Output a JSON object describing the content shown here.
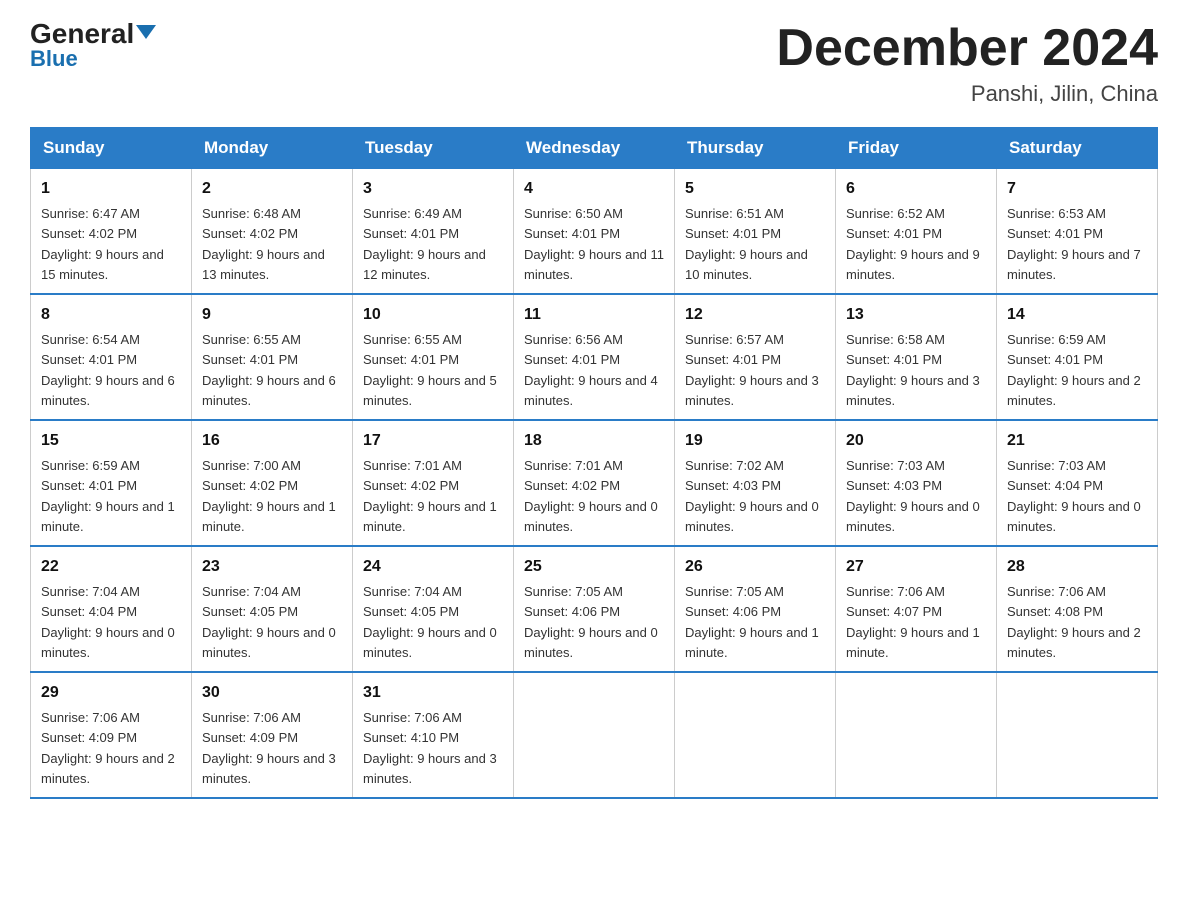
{
  "header": {
    "logo_general": "General",
    "logo_blue": "Blue",
    "month_title": "December 2024",
    "location": "Panshi, Jilin, China"
  },
  "days_of_week": [
    "Sunday",
    "Monday",
    "Tuesday",
    "Wednesday",
    "Thursday",
    "Friday",
    "Saturday"
  ],
  "weeks": [
    [
      {
        "day": "1",
        "sunrise": "6:47 AM",
        "sunset": "4:02 PM",
        "daylight": "9 hours and 15 minutes."
      },
      {
        "day": "2",
        "sunrise": "6:48 AM",
        "sunset": "4:02 PM",
        "daylight": "9 hours and 13 minutes."
      },
      {
        "day": "3",
        "sunrise": "6:49 AM",
        "sunset": "4:01 PM",
        "daylight": "9 hours and 12 minutes."
      },
      {
        "day": "4",
        "sunrise": "6:50 AM",
        "sunset": "4:01 PM",
        "daylight": "9 hours and 11 minutes."
      },
      {
        "day": "5",
        "sunrise": "6:51 AM",
        "sunset": "4:01 PM",
        "daylight": "9 hours and 10 minutes."
      },
      {
        "day": "6",
        "sunrise": "6:52 AM",
        "sunset": "4:01 PM",
        "daylight": "9 hours and 9 minutes."
      },
      {
        "day": "7",
        "sunrise": "6:53 AM",
        "sunset": "4:01 PM",
        "daylight": "9 hours and 7 minutes."
      }
    ],
    [
      {
        "day": "8",
        "sunrise": "6:54 AM",
        "sunset": "4:01 PM",
        "daylight": "9 hours and 6 minutes."
      },
      {
        "day": "9",
        "sunrise": "6:55 AM",
        "sunset": "4:01 PM",
        "daylight": "9 hours and 6 minutes."
      },
      {
        "day": "10",
        "sunrise": "6:55 AM",
        "sunset": "4:01 PM",
        "daylight": "9 hours and 5 minutes."
      },
      {
        "day": "11",
        "sunrise": "6:56 AM",
        "sunset": "4:01 PM",
        "daylight": "9 hours and 4 minutes."
      },
      {
        "day": "12",
        "sunrise": "6:57 AM",
        "sunset": "4:01 PM",
        "daylight": "9 hours and 3 minutes."
      },
      {
        "day": "13",
        "sunrise": "6:58 AM",
        "sunset": "4:01 PM",
        "daylight": "9 hours and 3 minutes."
      },
      {
        "day": "14",
        "sunrise": "6:59 AM",
        "sunset": "4:01 PM",
        "daylight": "9 hours and 2 minutes."
      }
    ],
    [
      {
        "day": "15",
        "sunrise": "6:59 AM",
        "sunset": "4:01 PM",
        "daylight": "9 hours and 1 minute."
      },
      {
        "day": "16",
        "sunrise": "7:00 AM",
        "sunset": "4:02 PM",
        "daylight": "9 hours and 1 minute."
      },
      {
        "day": "17",
        "sunrise": "7:01 AM",
        "sunset": "4:02 PM",
        "daylight": "9 hours and 1 minute."
      },
      {
        "day": "18",
        "sunrise": "7:01 AM",
        "sunset": "4:02 PM",
        "daylight": "9 hours and 0 minutes."
      },
      {
        "day": "19",
        "sunrise": "7:02 AM",
        "sunset": "4:03 PM",
        "daylight": "9 hours and 0 minutes."
      },
      {
        "day": "20",
        "sunrise": "7:03 AM",
        "sunset": "4:03 PM",
        "daylight": "9 hours and 0 minutes."
      },
      {
        "day": "21",
        "sunrise": "7:03 AM",
        "sunset": "4:04 PM",
        "daylight": "9 hours and 0 minutes."
      }
    ],
    [
      {
        "day": "22",
        "sunrise": "7:04 AM",
        "sunset": "4:04 PM",
        "daylight": "9 hours and 0 minutes."
      },
      {
        "day": "23",
        "sunrise": "7:04 AM",
        "sunset": "4:05 PM",
        "daylight": "9 hours and 0 minutes."
      },
      {
        "day": "24",
        "sunrise": "7:04 AM",
        "sunset": "4:05 PM",
        "daylight": "9 hours and 0 minutes."
      },
      {
        "day": "25",
        "sunrise": "7:05 AM",
        "sunset": "4:06 PM",
        "daylight": "9 hours and 0 minutes."
      },
      {
        "day": "26",
        "sunrise": "7:05 AM",
        "sunset": "4:06 PM",
        "daylight": "9 hours and 1 minute."
      },
      {
        "day": "27",
        "sunrise": "7:06 AM",
        "sunset": "4:07 PM",
        "daylight": "9 hours and 1 minute."
      },
      {
        "day": "28",
        "sunrise": "7:06 AM",
        "sunset": "4:08 PM",
        "daylight": "9 hours and 2 minutes."
      }
    ],
    [
      {
        "day": "29",
        "sunrise": "7:06 AM",
        "sunset": "4:09 PM",
        "daylight": "9 hours and 2 minutes."
      },
      {
        "day": "30",
        "sunrise": "7:06 AM",
        "sunset": "4:09 PM",
        "daylight": "9 hours and 3 minutes."
      },
      {
        "day": "31",
        "sunrise": "7:06 AM",
        "sunset": "4:10 PM",
        "daylight": "9 hours and 3 minutes."
      },
      null,
      null,
      null,
      null
    ]
  ]
}
